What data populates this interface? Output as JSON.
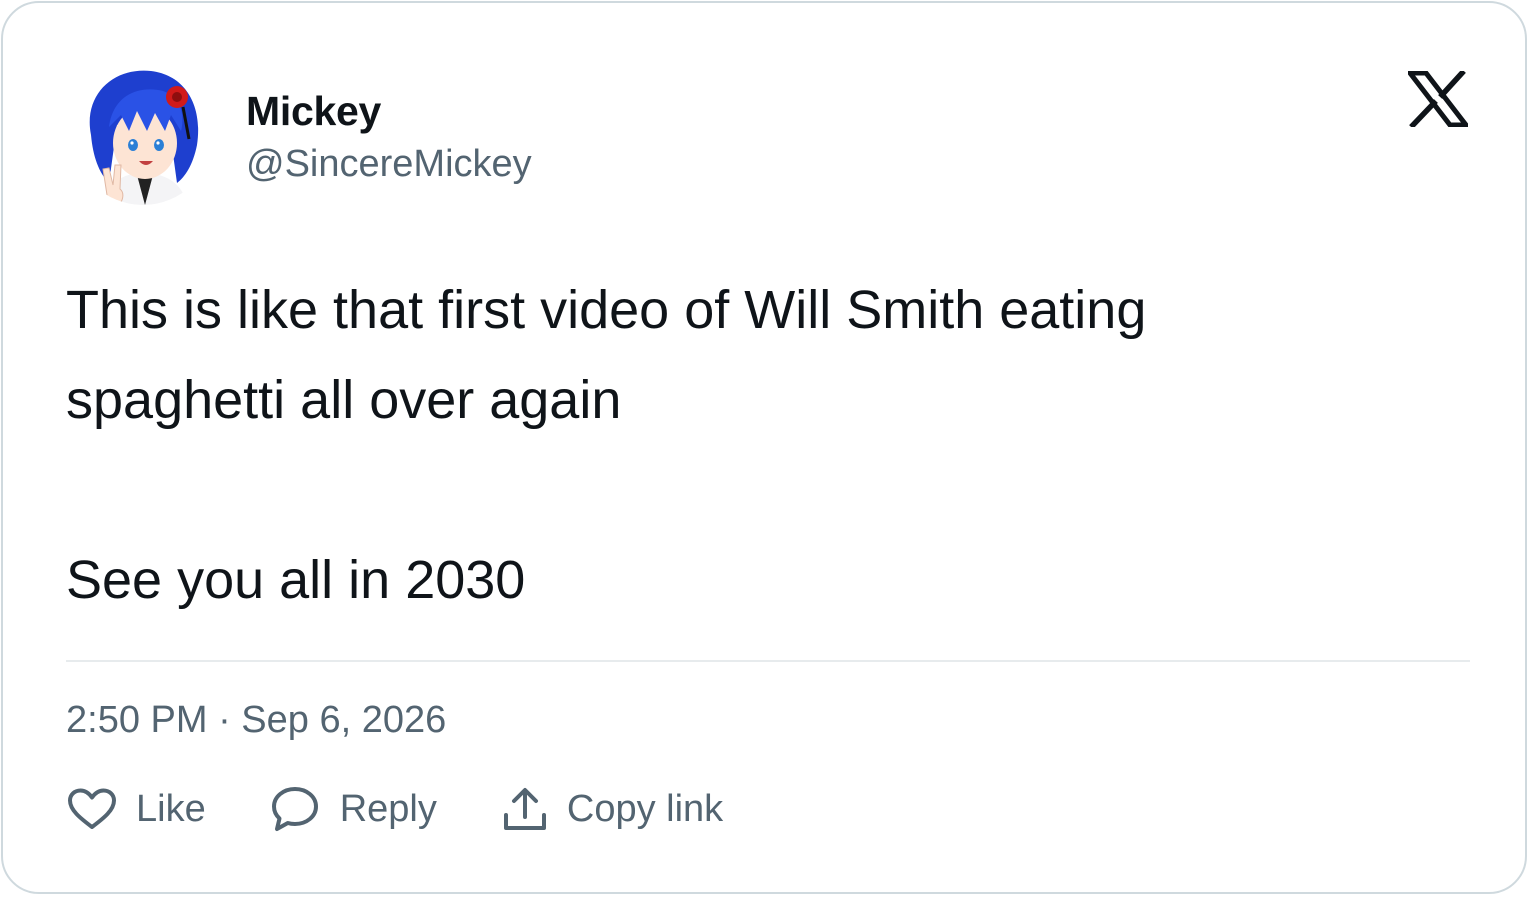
{
  "author": {
    "display_name": "Mickey",
    "handle": "@SincereMickey",
    "avatar_icon": "anime-avatar-blue-hair"
  },
  "brand": {
    "logo_icon": "x-logo-icon"
  },
  "tweet": {
    "lines": [
      "This is like that first video of Will Smith eating",
      "spaghetti all over again",
      "See you all in 2030"
    ]
  },
  "timestamp": "2:50 PM · Sep 6, 2026",
  "actions": {
    "like": {
      "label": "Like",
      "icon": "heart-icon"
    },
    "reply": {
      "label": "Reply",
      "icon": "speech-bubble-icon"
    },
    "copy_link": {
      "label": "Copy link",
      "icon": "share-upload-icon"
    }
  },
  "colors": {
    "text_primary": "#0f1419",
    "text_secondary": "#536471",
    "border": "#cfd9de",
    "avatar_hair": "#1f47d8",
    "avatar_rose": "#d11a1a"
  }
}
